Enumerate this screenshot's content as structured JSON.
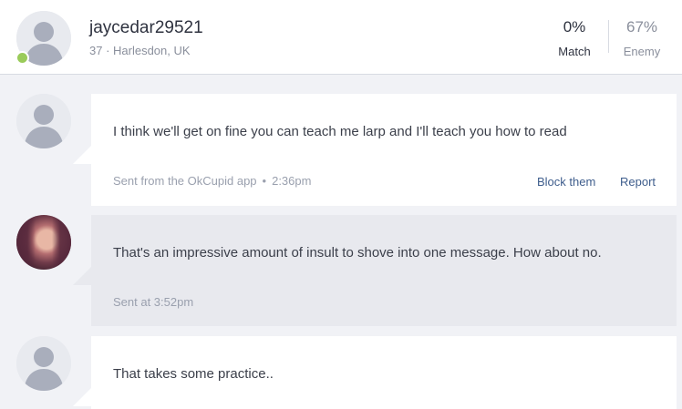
{
  "header": {
    "username": "jaycedar29521",
    "info": "37 · Harlesdon, UK",
    "match": {
      "value": "0%",
      "label": "Match"
    },
    "enemy": {
      "value": "67%",
      "label": "Enemy"
    }
  },
  "messages": [
    {
      "from": "them",
      "text": "I think we'll get on fine you can teach me larp and I'll teach you how to read",
      "source": "Sent from the OkCupid app",
      "time": "2:36pm",
      "actions": {
        "block": "Block them",
        "report": "Report"
      }
    },
    {
      "from": "me",
      "text": "That's an impressive amount of insult to shove into one message. How about no.",
      "meta": "Sent at 3:52pm"
    },
    {
      "from": "them",
      "text": "That takes some practice.."
    }
  ],
  "colors": {
    "online": "#9acb5a",
    "link": "#3e5d8c",
    "my_bubble": "#e8e9ee",
    "their_bubble": "#ffffff"
  }
}
